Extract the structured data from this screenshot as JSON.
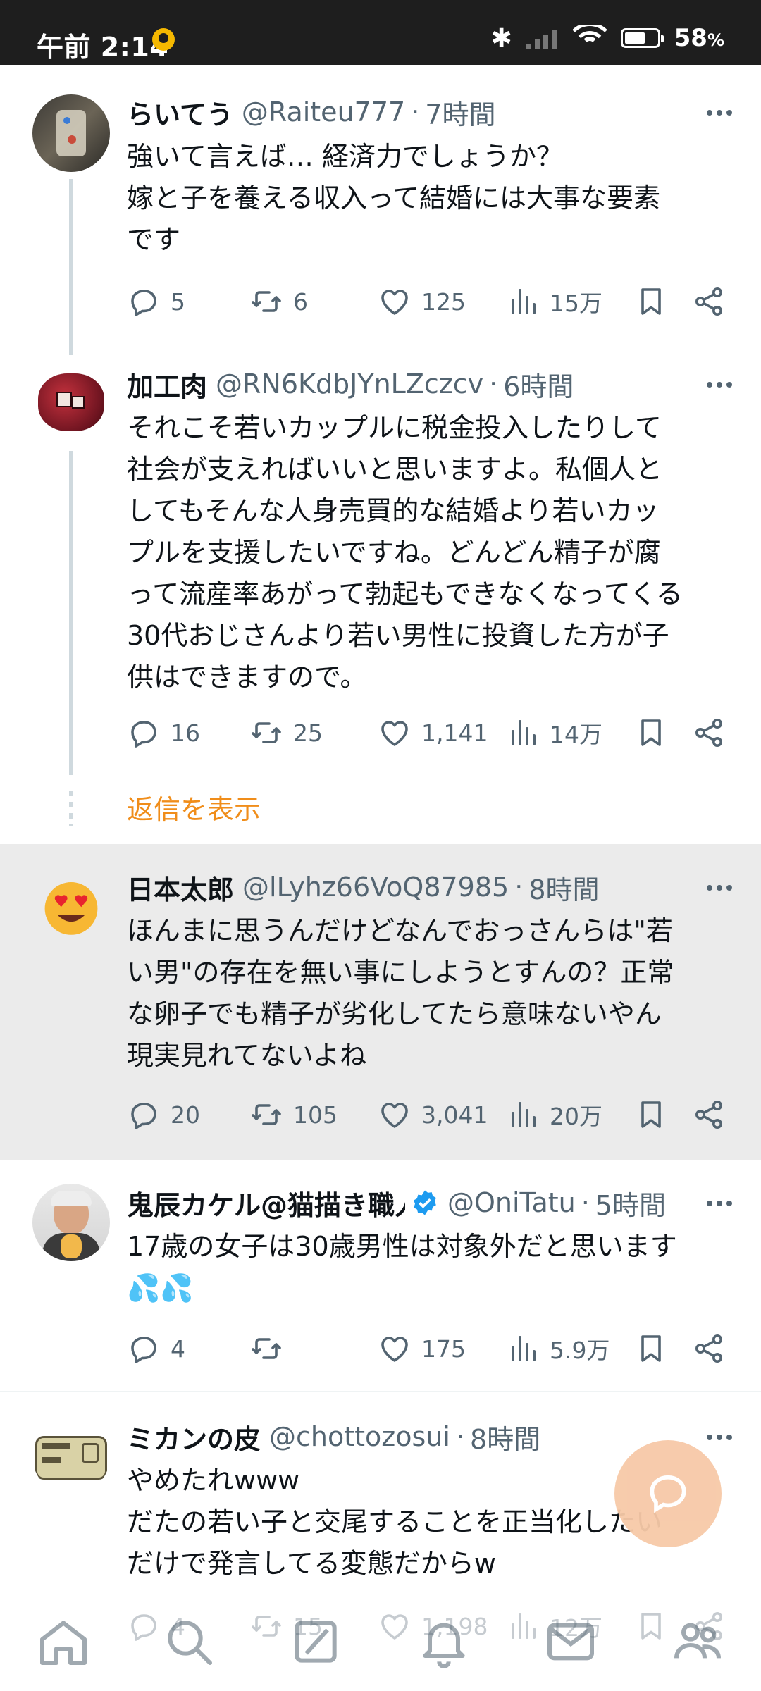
{
  "status_bar": {
    "time": "午前 2:14",
    "battery": "58",
    "battery_unit": "%"
  },
  "tweets": [
    {
      "name": "らいてう",
      "handle": "@Raiteu777",
      "time": "7時間",
      "text": "強いて言えば… 経済力でしょうか？\n嫁と子を養える収入って結婚には大事な要素\nです",
      "replies": "5",
      "retweets": "6",
      "likes": "125",
      "views": "15万"
    },
    {
      "name": "加工肉",
      "handle": "@RN6KdbJYnLZczcv",
      "time": "6時間",
      "text": "それこそ若いカップルに税金投入したりして\n社会が支えればいいと思いますよ。私個人と\nしてもそんな人身売買的な結婚より若いカッ\nプルを支援したいですね。どんどん精子が腐\nって流産率あがって勃起もできなくなってくる\n30代おじさんより若い男性に投資した方が子\n供はできますので。",
      "replies": "16",
      "retweets": "25",
      "likes": "1,141",
      "views": "14万"
    },
    {
      "name": "日本太郎",
      "handle": "@lLyhz66VoQ87985",
      "time": "8時間",
      "text": "ほんまに思うんだけどなんでおっさんらは\"若\nい男\"の存在を無い事にしようとすんの？正常\nな卵子でも精子が劣化してたら意味ないやん\n現実見れてないよね",
      "replies": "20",
      "retweets": "105",
      "likes": "3,041",
      "views": "20万"
    },
    {
      "name": "鬼辰カケル@猫描き職人",
      "handle": "@OniTatu",
      "time": "5時間",
      "text": "17歳の女子は30歳男性は対象外だと思います\n💦💦",
      "replies": "4",
      "retweets": "",
      "likes": "175",
      "views": "5.9万"
    },
    {
      "name": "ミカンの皮",
      "handle": "@chottozosui",
      "time": "8時間",
      "text": "やめたれwww\nだたの若い子と交尾することを正当化したい\nだけで発言してる変態だからw",
      "replies": "4",
      "retweets": "15",
      "likes": "1,198",
      "views": "12万"
    }
  ],
  "show_replies_label": "返信を表示",
  "colors": {
    "accent": "#f08d1a",
    "secondary_text": "#536471",
    "highlight_bg": "#ebebeb",
    "verified": "#1d9bf0"
  },
  "icons": {
    "reply": "reply-icon",
    "retweet": "retweet-icon",
    "like": "heart-icon",
    "views": "views-icon",
    "bookmark": "bookmark-icon",
    "share": "share-icon",
    "more": "more-icon",
    "compose": "compose-icon"
  },
  "bottom_nav": [
    "home-icon",
    "search-icon",
    "grok-icon",
    "notifications-icon",
    "messages-icon",
    "communities-icon"
  ]
}
